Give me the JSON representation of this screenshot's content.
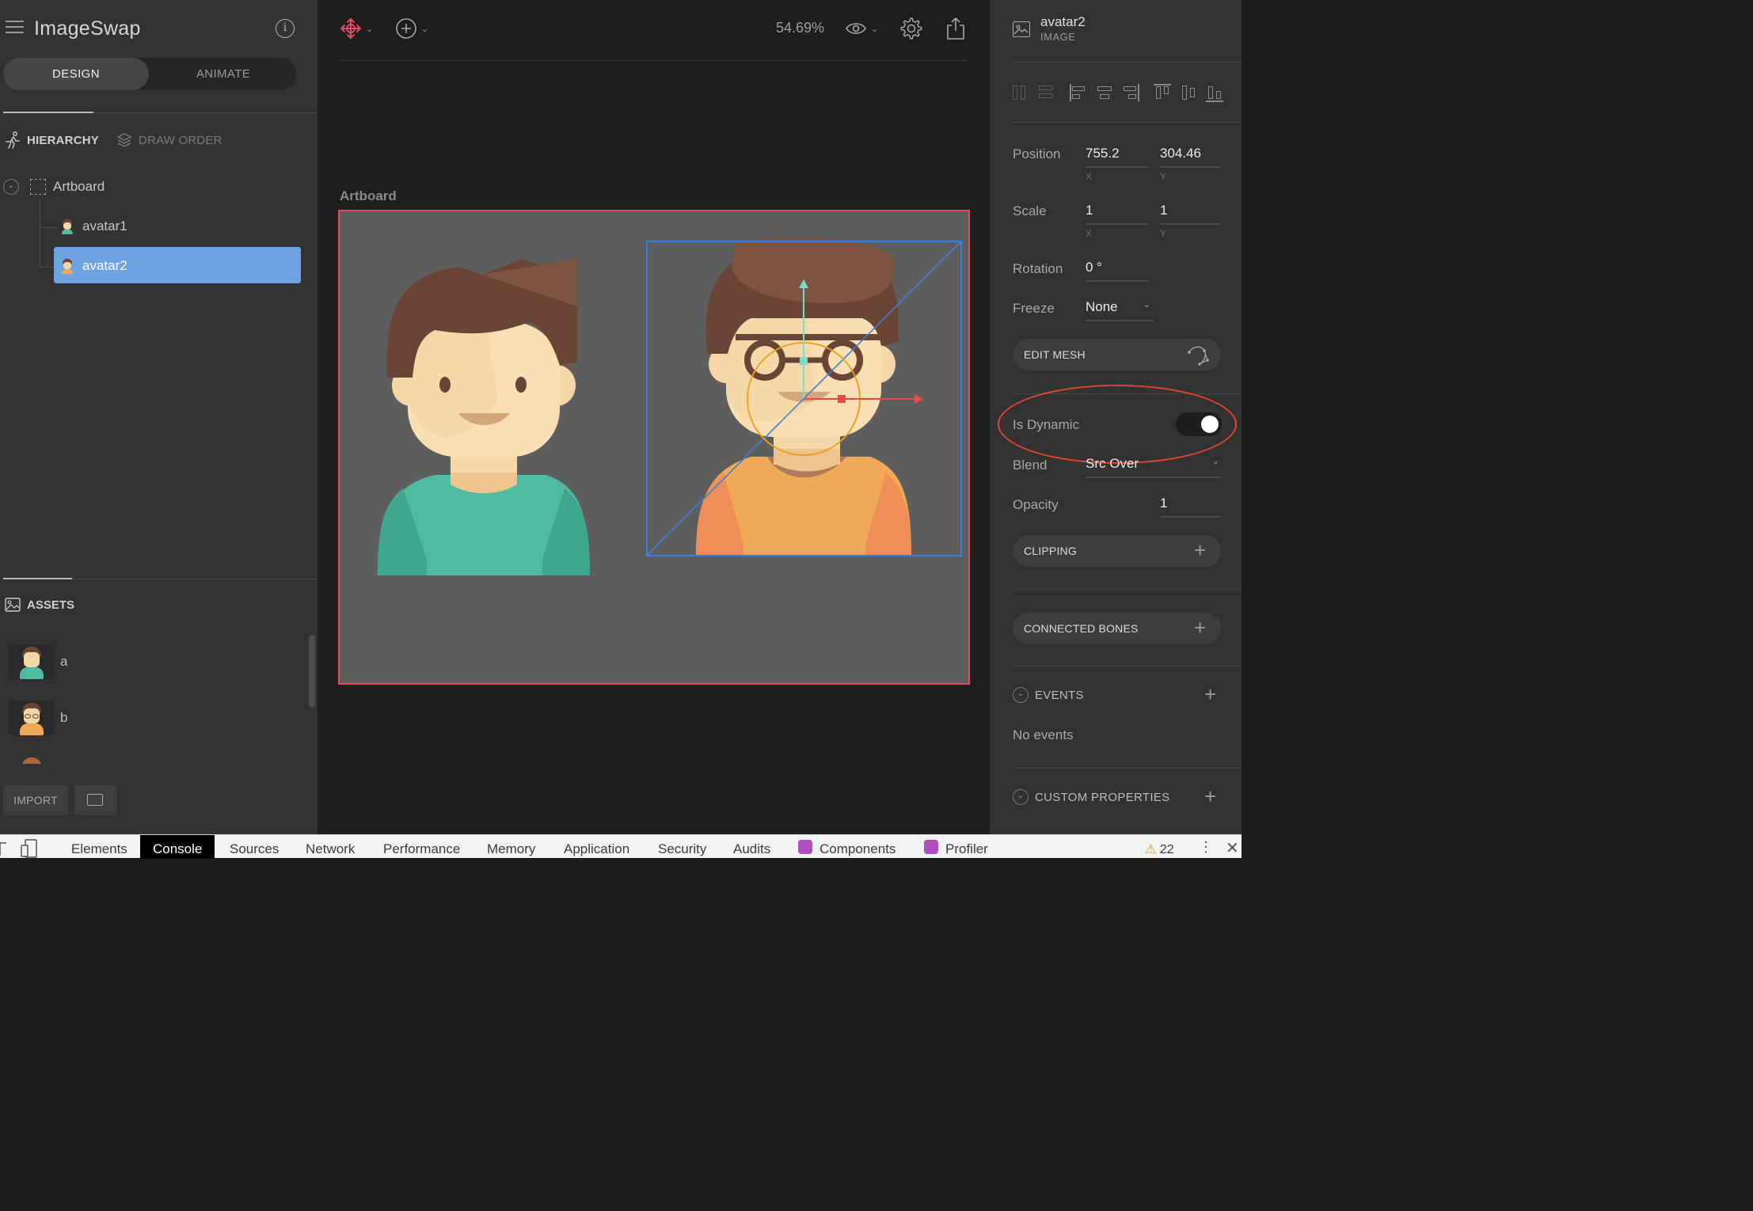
{
  "app": {
    "title": "ImageSwap"
  },
  "left_panel": {
    "mode_tabs": [
      {
        "label": "DESIGN",
        "active": true
      },
      {
        "label": "ANIMATE",
        "active": false
      }
    ],
    "section_tabs": [
      {
        "label": "HIERARCHY",
        "active": true
      },
      {
        "label": "DRAW ORDER",
        "active": false
      }
    ],
    "tree": [
      {
        "label": "Artboard",
        "type": "artboard",
        "expanded": true
      },
      {
        "label": "avatar1",
        "type": "image",
        "selected": false
      },
      {
        "label": "avatar2",
        "type": "image",
        "selected": true
      }
    ],
    "assets": {
      "title": "ASSETS",
      "items": [
        {
          "label": "a"
        },
        {
          "label": "b"
        }
      ]
    },
    "import_label": "IMPORT"
  },
  "canvas": {
    "zoom": "54.69%",
    "artboard_label": "Artboard"
  },
  "inspector": {
    "name": "avatar2",
    "type": "IMAGE",
    "position": {
      "label": "Position",
      "x": "755.2",
      "y": "304.46",
      "x_axis": "X",
      "y_axis": "Y"
    },
    "scale": {
      "label": "Scale",
      "x": "1",
      "y": "1",
      "x_axis": "X",
      "y_axis": "Y"
    },
    "rotation": {
      "label": "Rotation",
      "value": "0 °"
    },
    "freeze": {
      "label": "Freeze",
      "value": "None"
    },
    "edit_mesh_label": "EDIT MESH",
    "is_dynamic": {
      "label": "Is Dynamic",
      "on": true
    },
    "blend": {
      "label": "Blend",
      "value": "Src Over"
    },
    "opacity": {
      "label": "Opacity",
      "value": "1"
    },
    "clipping_label": "CLIPPING",
    "connected_bones_label": "CONNECTED BONES",
    "events": {
      "label": "EVENTS",
      "empty_text": "No events"
    },
    "custom_properties_label": "CUSTOM PROPERTIES"
  },
  "devtools": {
    "tabs": [
      "Elements",
      "Console",
      "Sources",
      "Network",
      "Performance",
      "Memory",
      "Application",
      "Security",
      "Audits",
      "Components",
      "Profiler"
    ],
    "active_tab": "Console",
    "warning_count": "22"
  },
  "colors": {
    "selection": "#6ea2e0",
    "artboard_border": "#e64a63",
    "highlight": "#e0442a",
    "avatar1_shirt": "#4fbba3",
    "avatar2_shirt": "#f0a956"
  }
}
